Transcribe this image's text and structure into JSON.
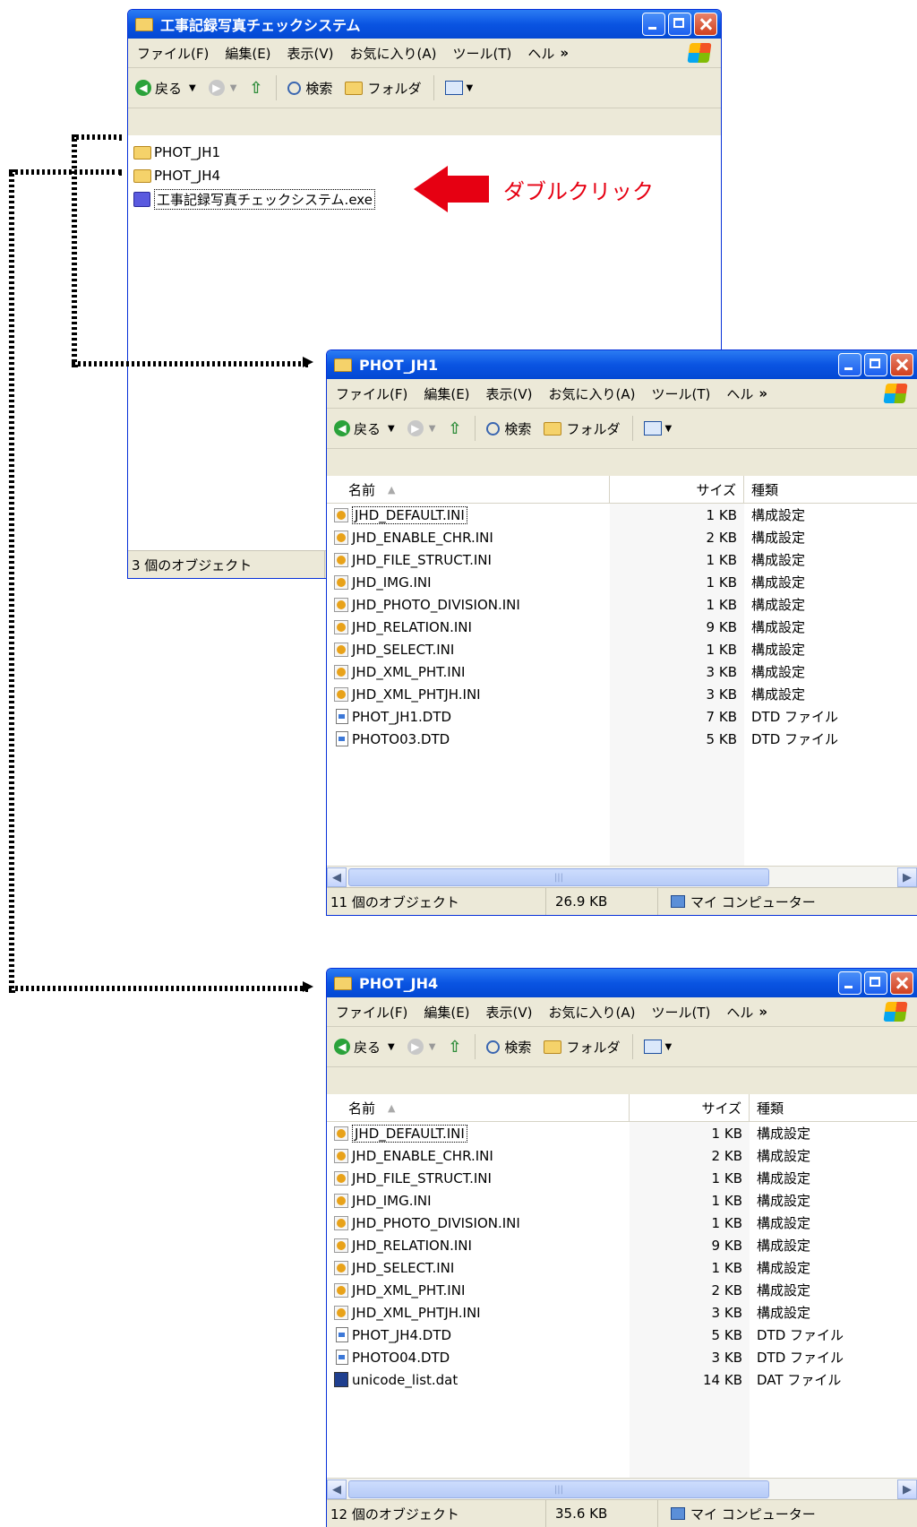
{
  "main_window": {
    "title": "工事記録写真チェックシステム",
    "menu": [
      "ファイル(F)",
      "編集(E)",
      "表示(V)",
      "お気に入り(A)",
      "ツール(T)",
      "ヘル"
    ],
    "menu_more": "»",
    "toolbar": {
      "back": "戻る",
      "search": "検索",
      "folders": "フォルダ"
    },
    "items": [
      {
        "name": "PHOT_JH1",
        "icon": "folder-icon"
      },
      {
        "name": "PHOT_JH4",
        "icon": "folder-icon"
      },
      {
        "name": "工事記録写真チェックシステム.exe",
        "icon": "camera-exe-icon"
      }
    ],
    "status": "3 個のオブジェクト"
  },
  "annotation": {
    "label": "ダブルクリック",
    "color": "#e60012"
  },
  "jh1_window": {
    "title": "PHOT_JH1",
    "menu": [
      "ファイル(F)",
      "編集(E)",
      "表示(V)",
      "お気に入り(A)",
      "ツール(T)",
      "ヘル"
    ],
    "menu_more": "»",
    "toolbar": {
      "back": "戻る",
      "search": "検索",
      "folders": "フォルダ"
    },
    "columns": {
      "name": "名前",
      "size": "サイズ",
      "type": "種類"
    },
    "files": [
      {
        "name": "JHD_DEFAULT.INI",
        "size": "1 KB",
        "type": "構成設定"
      },
      {
        "name": "JHD_ENABLE_CHR.INI",
        "size": "2 KB",
        "type": "構成設定"
      },
      {
        "name": "JHD_FILE_STRUCT.INI",
        "size": "1 KB",
        "type": "構成設定"
      },
      {
        "name": "JHD_IMG.INI",
        "size": "1 KB",
        "type": "構成設定"
      },
      {
        "name": "JHD_PHOTO_DIVISION.INI",
        "size": "1 KB",
        "type": "構成設定"
      },
      {
        "name": "JHD_RELATION.INI",
        "size": "9 KB",
        "type": "構成設定"
      },
      {
        "name": "JHD_SELECT.INI",
        "size": "1 KB",
        "type": "構成設定"
      },
      {
        "name": "JHD_XML_PHT.INI",
        "size": "3 KB",
        "type": "構成設定"
      },
      {
        "name": "JHD_XML_PHTJH.INI",
        "size": "3 KB",
        "type": "構成設定"
      },
      {
        "name": "PHOT_JH1.DTD",
        "size": "7 KB",
        "type": "DTD ファイル"
      },
      {
        "name": "PHOTO03.DTD",
        "size": "5 KB",
        "type": "DTD ファイル"
      }
    ],
    "status": {
      "count": "11 個のオブジェクト",
      "size": "26.9 KB",
      "location": "マイ コンピューター"
    }
  },
  "jh4_window": {
    "title": "PHOT_JH4",
    "menu": [
      "ファイル(F)",
      "編集(E)",
      "表示(V)",
      "お気に入り(A)",
      "ツール(T)",
      "ヘル"
    ],
    "menu_more": "»",
    "toolbar": {
      "back": "戻る",
      "search": "検索",
      "folders": "フォルダ"
    },
    "columns": {
      "name": "名前",
      "size": "サイズ",
      "type": "種類"
    },
    "files": [
      {
        "name": "JHD_DEFAULT.INI",
        "size": "1 KB",
        "type": "構成設定"
      },
      {
        "name": "JHD_ENABLE_CHR.INI",
        "size": "2 KB",
        "type": "構成設定"
      },
      {
        "name": "JHD_FILE_STRUCT.INI",
        "size": "1 KB",
        "type": "構成設定"
      },
      {
        "name": "JHD_IMG.INI",
        "size": "1 KB",
        "type": "構成設定"
      },
      {
        "name": "JHD_PHOTO_DIVISION.INI",
        "size": "1 KB",
        "type": "構成設定"
      },
      {
        "name": "JHD_RELATION.INI",
        "size": "9 KB",
        "type": "構成設定"
      },
      {
        "name": "JHD_SELECT.INI",
        "size": "1 KB",
        "type": "構成設定"
      },
      {
        "name": "JHD_XML_PHT.INI",
        "size": "2 KB",
        "type": "構成設定"
      },
      {
        "name": "JHD_XML_PHTJH.INI",
        "size": "3 KB",
        "type": "構成設定"
      },
      {
        "name": "PHOT_JH4.DTD",
        "size": "5 KB",
        "type": "DTD ファイル"
      },
      {
        "name": "PHOTO04.DTD",
        "size": "3 KB",
        "type": "DTD ファイル"
      },
      {
        "name": "unicode_list.dat",
        "size": "14 KB",
        "type": "DAT ファイル"
      }
    ],
    "status": {
      "count": "12 個のオブジェクト",
      "size": "35.6 KB",
      "location": "マイ コンピューター"
    }
  }
}
